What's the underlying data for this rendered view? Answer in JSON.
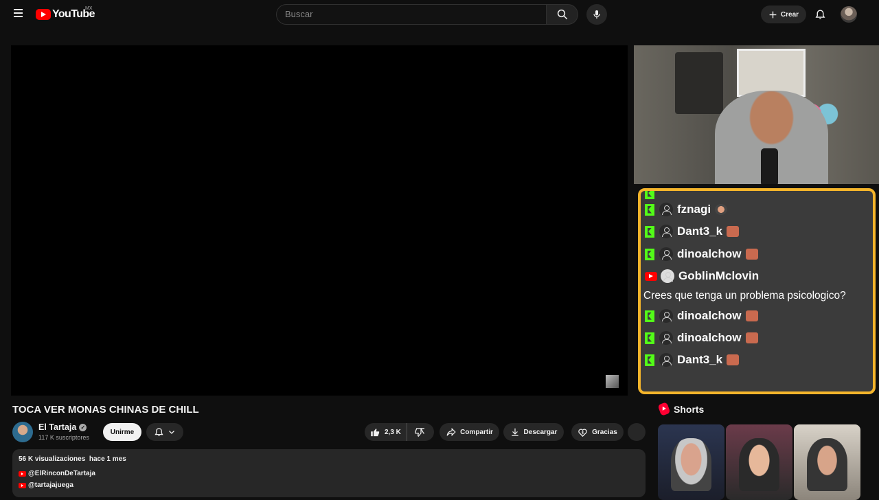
{
  "header": {
    "logo_text": "YouTube",
    "region": "MX",
    "search_placeholder": "Buscar",
    "create_label": "Crear"
  },
  "chat": {
    "rows": [
      {
        "platform": "kick",
        "name": "fznagi",
        "emote": "avatar-emote"
      },
      {
        "platform": "kick",
        "name": "Dant3_k",
        "emote": "face-emote"
      },
      {
        "platform": "kick",
        "name": "dinoalchow",
        "emote": "face-emote"
      },
      {
        "platform": "youtube",
        "name": "GoblinMclovin",
        "emote": ""
      },
      {
        "platform": "kick",
        "name": "dinoalchow",
        "emote": "face-emote"
      },
      {
        "platform": "kick",
        "name": "dinoalchow",
        "emote": "face-emote"
      },
      {
        "platform": "kick",
        "name": "Dant3_k",
        "emote": "face-emote"
      }
    ],
    "message": "Crees que tenga un problema psicologico?",
    "border_color": "#f5b52b"
  },
  "video": {
    "title": "TOCA VER MONAS CHINAS DE CHILL",
    "channel": "El Tartaja",
    "subscribers": "117 K suscriptores",
    "join_label": "Unirme",
    "likes": "2,3 K",
    "share_label": "Compartir",
    "download_label": "Descargar",
    "thanks_label": "Gracias"
  },
  "description": {
    "views": "56 K visualizaciones",
    "date": "hace 1 mes",
    "links": [
      "@ElRinconDeTartaja",
      "@tartajajuega"
    ]
  },
  "shorts": {
    "heading": "Shorts"
  },
  "colors": {
    "kick_green": "#53fc18",
    "youtube_red": "#ff0000",
    "background": "#0f0f0f"
  }
}
